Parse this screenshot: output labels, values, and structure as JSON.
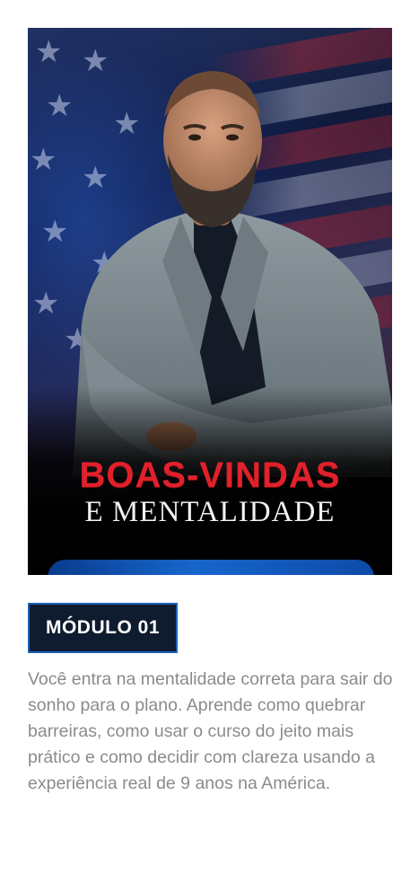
{
  "card": {
    "cover_title_line1": "BOAS-VINDAS",
    "cover_title_line2": "E MENTALIDADE",
    "module_label": "MÓDULO 01",
    "description": "Você entra na mentalidade correta para sair do sonho para o plano. Aprende como quebrar barreiras, como usar o curso do jeito mais prático e como decidir com clareza usando a experiência real de 9 anos na América."
  },
  "colors": {
    "title_red": "#e0212b",
    "badge_bg": "#0f1b2f",
    "badge_border": "#1c63b8",
    "description_text": "#8b8b8b"
  }
}
